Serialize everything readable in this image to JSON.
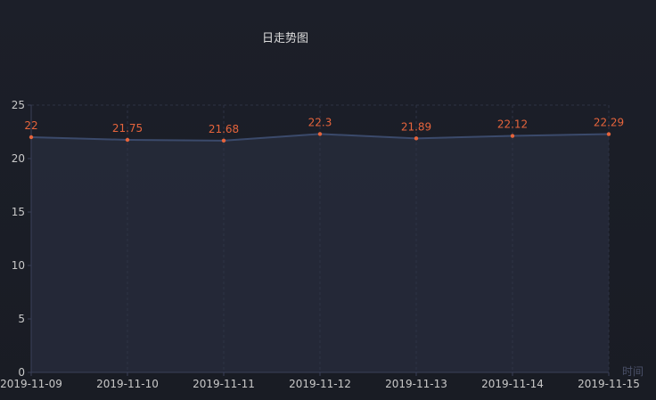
{
  "chart_data": {
    "type": "area",
    "title": "日走势图",
    "xlabel": "时间",
    "ylabel": "",
    "categories": [
      "2019-11-09",
      "2019-11-10",
      "2019-11-11",
      "2019-11-12",
      "2019-11-13",
      "2019-11-14",
      "2019-11-15"
    ],
    "series": [
      {
        "values": [
          22,
          21.75,
          21.68,
          22.3,
          21.89,
          22.12,
          22.29
        ],
        "data_labels": [
          "22",
          "21.75",
          "21.68",
          "22.3",
          "21.89",
          "22.12",
          "22.29"
        ]
      }
    ],
    "ylim": [
      0,
      25
    ],
    "yticks": [
      0,
      5,
      10,
      15,
      20,
      25
    ],
    "grid": true,
    "colors": {
      "line": "#3b4a6b",
      "area": "#262a3a",
      "point": "#e6643c",
      "label": "#e6643c",
      "axis": "#3a4058",
      "grid": "#2e3344"
    }
  }
}
